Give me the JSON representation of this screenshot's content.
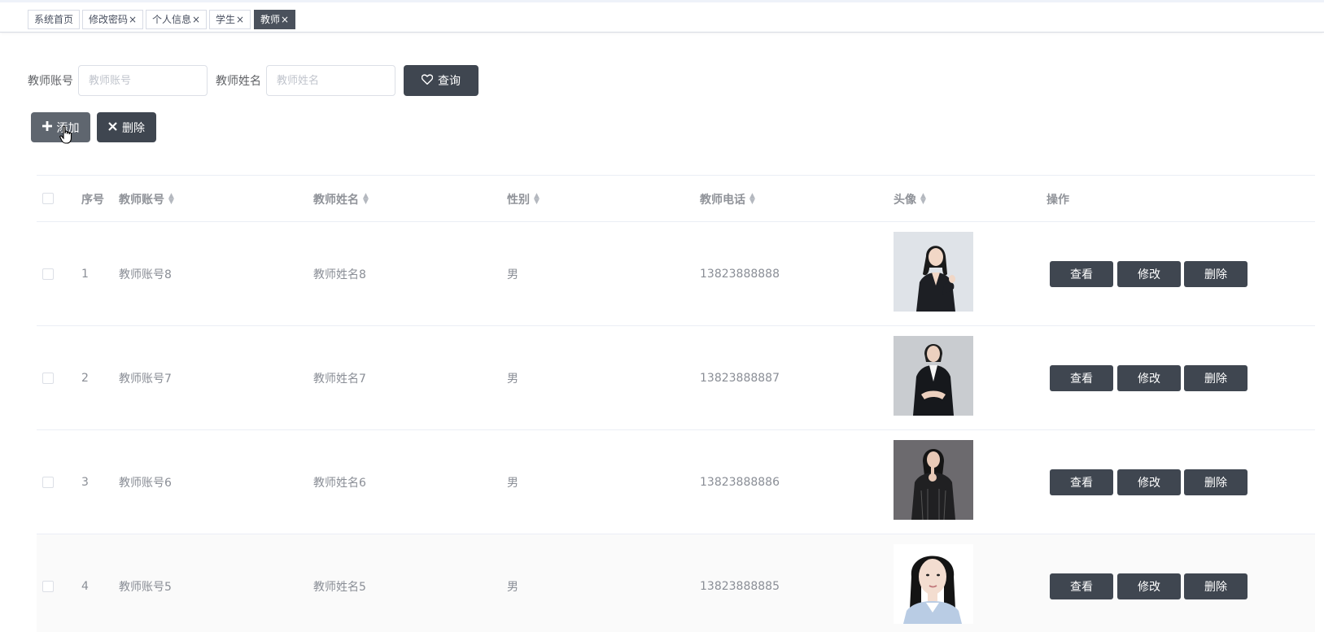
{
  "tags": [
    {
      "label": "系统首页",
      "closable": false,
      "active": false
    },
    {
      "label": "修改密码",
      "closable": true,
      "active": false
    },
    {
      "label": "个人信息",
      "closable": true,
      "active": false
    },
    {
      "label": "学生",
      "closable": true,
      "active": false
    },
    {
      "label": "教师",
      "closable": true,
      "active": true
    }
  ],
  "tag_close_glyph": "×",
  "search": {
    "account_label": "教师账号",
    "account_placeholder": "教师账号",
    "account_value": "",
    "name_label": "教师姓名",
    "name_placeholder": "教师姓名",
    "name_value": "",
    "query_label": "查询",
    "query_icon": "heart-icon"
  },
  "actions": {
    "add_label": "添加",
    "add_icon": "plus-icon",
    "delete_label": "删除",
    "delete_icon": "close-icon"
  },
  "table": {
    "columns": [
      "序号",
      "教师账号",
      "教师姓名",
      "性别",
      "教师电话",
      "头像",
      "操作"
    ],
    "rows": [
      {
        "index": "1",
        "account": "教师账号8",
        "name": "教师姓名8",
        "gender": "男",
        "phone": "13823888888"
      },
      {
        "index": "2",
        "account": "教师账号7",
        "name": "教师姓名7",
        "gender": "男",
        "phone": "13823888887"
      },
      {
        "index": "3",
        "account": "教师账号6",
        "name": "教师姓名6",
        "gender": "男",
        "phone": "13823888886"
      },
      {
        "index": "4",
        "account": "教师账号5",
        "name": "教师姓名5",
        "gender": "男",
        "phone": "13823888885"
      }
    ],
    "row_actions": [
      "查看",
      "修改",
      "删除"
    ]
  },
  "colors": {
    "primary_dark": "#3f4650",
    "active_tag": "#4a515c",
    "border": "#dcdfe6"
  }
}
